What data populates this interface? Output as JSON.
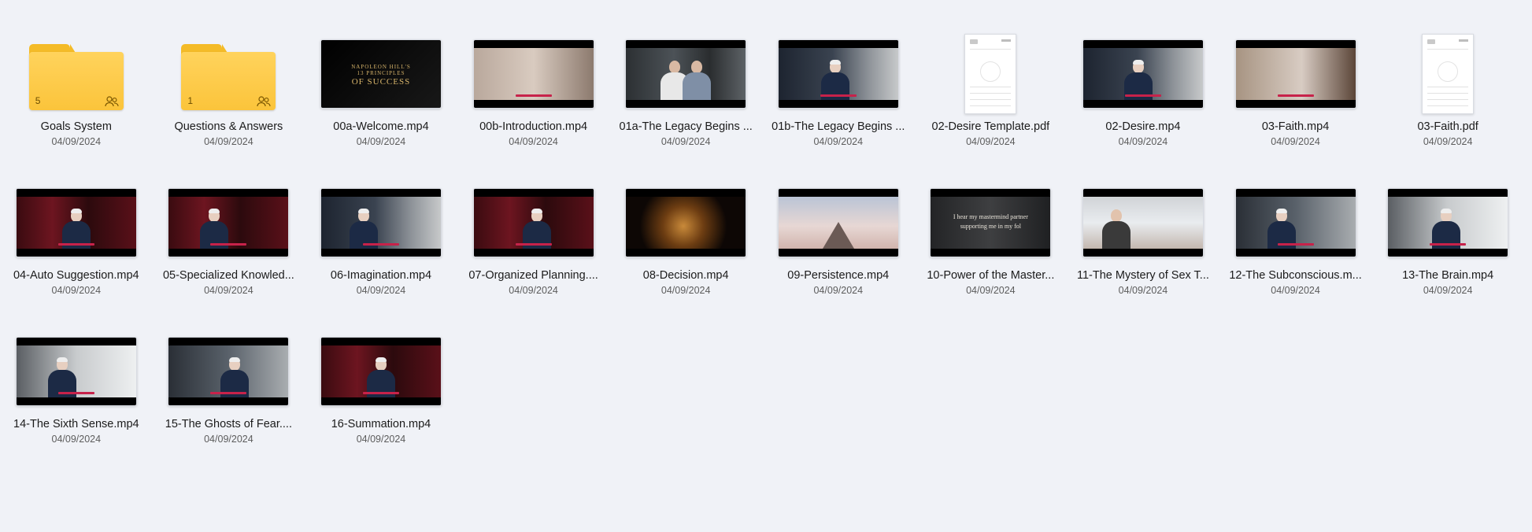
{
  "items": [
    {
      "name": "Goals System",
      "date": "04/09/2024",
      "kind": "folder",
      "count": "5",
      "icon": "shared-people-icon"
    },
    {
      "name": "Questions & Answers",
      "date": "04/09/2024",
      "kind": "folder",
      "count": "1",
      "icon": "shared-people-icon"
    },
    {
      "name": "00a-Welcome.mp4",
      "date": "04/09/2024",
      "kind": "video",
      "thumb_small": "NAPOLEON HILL'S",
      "thumb_line2": "13 PRINCIPLES",
      "thumb_big": "OF SUCCESS"
    },
    {
      "name": "00b-Introduction.mp4",
      "date": "04/09/2024",
      "kind": "video"
    },
    {
      "name": "01a-The Legacy Begins ...",
      "date": "04/09/2024",
      "kind": "video"
    },
    {
      "name": "01b-The Legacy Begins ...",
      "date": "04/09/2024",
      "kind": "video"
    },
    {
      "name": "02-Desire Template.pdf",
      "date": "04/09/2024",
      "kind": "pdf"
    },
    {
      "name": "02-Desire.mp4",
      "date": "04/09/2024",
      "kind": "video"
    },
    {
      "name": "03-Faith.mp4",
      "date": "04/09/2024",
      "kind": "video"
    },
    {
      "name": "03-Faith.pdf",
      "date": "04/09/2024",
      "kind": "pdf"
    },
    {
      "name": "04-Auto Suggestion.mp4",
      "date": "04/09/2024",
      "kind": "video"
    },
    {
      "name": "05-Specialized Knowled...",
      "date": "04/09/2024",
      "kind": "video"
    },
    {
      "name": "06-Imagination.mp4",
      "date": "04/09/2024",
      "kind": "video"
    },
    {
      "name": "07-Organized Planning....",
      "date": "04/09/2024",
      "kind": "video"
    },
    {
      "name": "08-Decision.mp4",
      "date": "04/09/2024",
      "kind": "video"
    },
    {
      "name": "09-Persistence.mp4",
      "date": "04/09/2024",
      "kind": "video"
    },
    {
      "name": "10-Power of the Master...",
      "date": "04/09/2024",
      "kind": "video",
      "thumb_quote": "I hear my mastermind partner supporting me in my fol"
    },
    {
      "name": "11-The Mystery of Sex T...",
      "date": "04/09/2024",
      "kind": "video"
    },
    {
      "name": "12-The Subconscious.m...",
      "date": "04/09/2024",
      "kind": "video"
    },
    {
      "name": "13-The Brain.mp4",
      "date": "04/09/2024",
      "kind": "video"
    },
    {
      "name": "14-The Sixth Sense.mp4",
      "date": "04/09/2024",
      "kind": "video"
    },
    {
      "name": "15-The Ghosts of Fear....",
      "date": "04/09/2024",
      "kind": "video"
    },
    {
      "name": "16-Summation.mp4",
      "date": "04/09/2024",
      "kind": "video"
    }
  ],
  "colors": {
    "background": "#f0f2f7",
    "folder": "#fbc43b",
    "text": "#1b1b1b",
    "date": "#5c5c5c"
  }
}
